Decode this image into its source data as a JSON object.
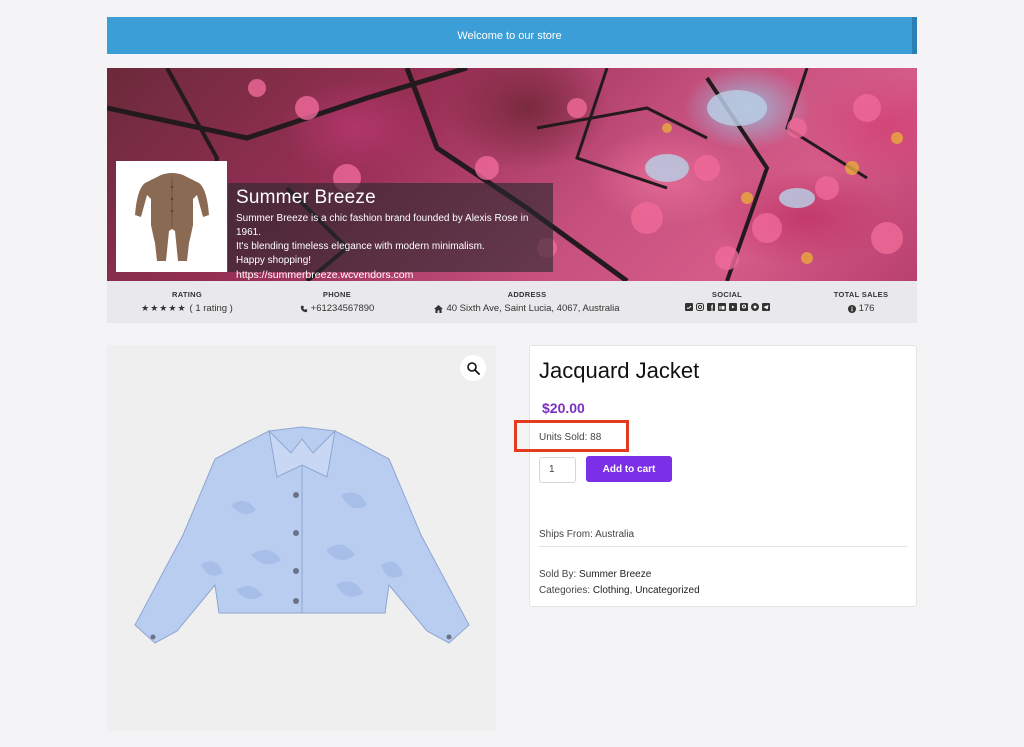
{
  "header": {
    "welcome_text": "Welcome to our store",
    "accent_color": "#3b9ed6"
  },
  "vendor": {
    "name": "Summer Breeze",
    "description": " Summer Breeze is a chic fashion brand founded by Alexis Rose in 1961.\nIt's blending timeless elegance with modern minimalism.\nHappy shopping!",
    "url": "https://summerbreeze.wcvendors.com",
    "logo_icon": "romper-product-image",
    "banner_image": "cherry-blossom-photo"
  },
  "stats": {
    "rating": {
      "title": "RATING",
      "stars": "★★★★★",
      "count_label": "( 1 rating )",
      "value": 5
    },
    "phone": {
      "title": "PHONE",
      "icon": "phone-icon",
      "value": "+61234567890"
    },
    "address": {
      "title": "ADDRESS",
      "icon": "home-icon",
      "value": "40 Sixth Ave, Saint Lucia, 4067, Australia"
    },
    "social": {
      "title": "SOCIAL",
      "icons": [
        "twitter-icon",
        "instagram-icon",
        "facebook-icon",
        "linkedin-icon",
        "youtube-icon",
        "pinterest-icon",
        "snapchat-icon",
        "telegram-icon"
      ]
    },
    "total_sales": {
      "title": "TOTAL SALES",
      "icon": "info-icon",
      "value": "176"
    }
  },
  "product": {
    "title": "Jacquard Jacket",
    "price": "$20.00",
    "units_sold": "Units Sold: 88",
    "quantity": "1",
    "add_to_cart_label": "Add to cart",
    "ships_from_label": "Ships From: ",
    "ships_from_value": "Australia",
    "sold_by_label": "Sold By: ",
    "sold_by_value": "Summer Breeze",
    "categories_label": "Categories: ",
    "category_1": "Clothing",
    "category_sep": ", ",
    "category_2": "Uncategorized",
    "image": "jacquard-jacket-photo",
    "price_color": "#7b2fbe",
    "button_color": "#7b2fe6",
    "highlight_color": "#e23b1d"
  }
}
